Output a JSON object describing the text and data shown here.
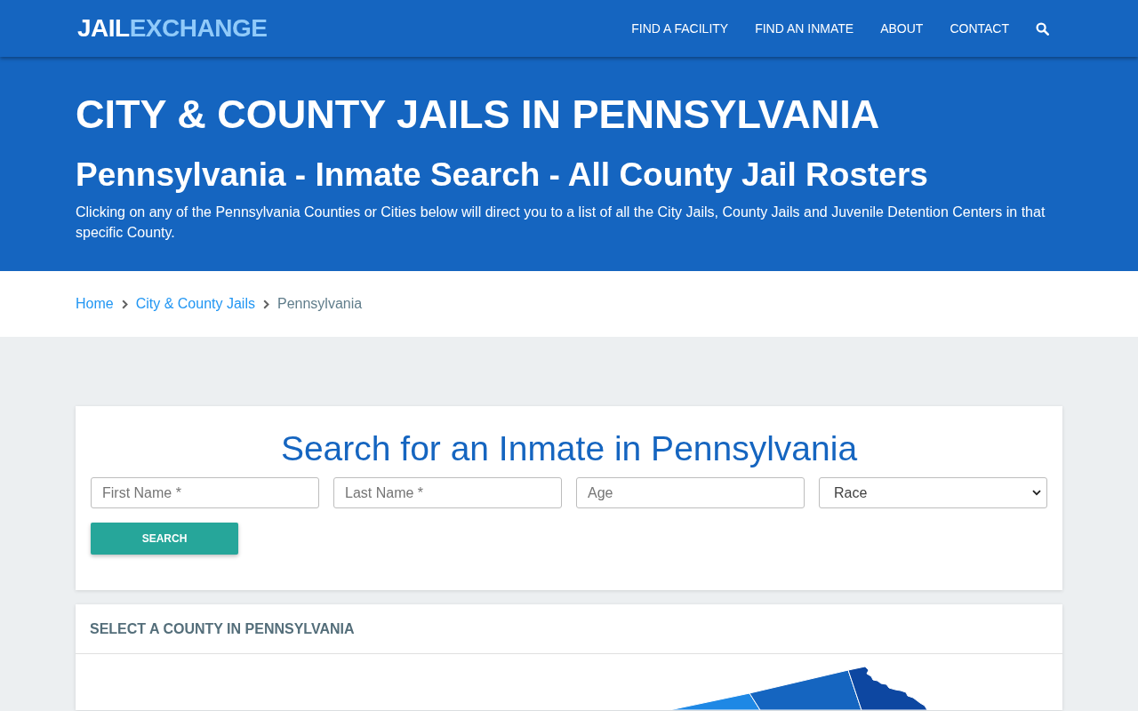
{
  "navbar": {
    "logo": {
      "primary": "JAIL",
      "accent": "EXCHANGE"
    },
    "links": [
      {
        "label": "FIND A FACILITY"
      },
      {
        "label": "FIND AN INMATE"
      },
      {
        "label": "ABOUT"
      },
      {
        "label": "CONTACT"
      }
    ]
  },
  "hero": {
    "title": "CITY & COUNTY JAILS IN PENNSYLVANIA",
    "subtitle": "Pennsylvania - Inmate Search - All County Jail Rosters",
    "description": "Clicking on any of the Pennsylvania Counties or Cities below will direct you to a list of all the City Jails, County Jails and Juvenile Detention Centers in that specific County."
  },
  "breadcrumb": [
    {
      "label": "Home",
      "kind": "link"
    },
    {
      "label": "City & County Jails",
      "kind": "link"
    },
    {
      "label": "Pennsylvania",
      "kind": "current"
    }
  ],
  "search_card": {
    "title": "Search for an Inmate in Pennsylvania",
    "fields": [
      {
        "kind": "input",
        "placeholder": "First Name *"
      },
      {
        "kind": "input",
        "placeholder": "Last Name *"
      },
      {
        "kind": "input",
        "placeholder": "Age"
      },
      {
        "kind": "select",
        "value": "Race"
      }
    ],
    "button": "SEARCH"
  },
  "county_card": {
    "heading": "SELECT A COUNTY IN PENNSYLVANIA"
  }
}
